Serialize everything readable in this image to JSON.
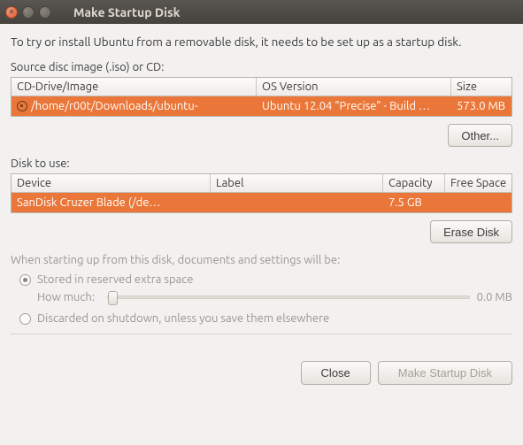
{
  "window": {
    "title": "Make Startup Disk"
  },
  "intro": "To try or install Ubuntu from a removable disk, it needs to be set up as a startup disk.",
  "source": {
    "label": "Source disc image (.iso) or CD:",
    "columns": [
      "CD-Drive/Image",
      "OS Version",
      "Size"
    ],
    "row": {
      "path": "/home/r00t/Downloads/ubuntu-",
      "os": "Ubuntu 12.04 \"Precise\" - Build …",
      "size": "573.0 MB"
    },
    "other_btn": "Other..."
  },
  "disk": {
    "label": "Disk to use:",
    "columns": [
      "Device",
      "Label",
      "Capacity",
      "Free Space"
    ],
    "row": {
      "device": "SanDisk Cruzer Blade (/de…",
      "label": "",
      "capacity": "7.5 GB",
      "free": ""
    },
    "erase_btn": "Erase Disk"
  },
  "options": {
    "heading": "When starting up from this disk, documents and settings will be:",
    "opt1": "Stored in reserved extra space",
    "how_much": "How much:",
    "slider_value": "0.0 MB",
    "opt2": "Discarded on shutdown, unless you save them elsewhere"
  },
  "footer": {
    "close": "Close",
    "make": "Make Startup Disk"
  }
}
